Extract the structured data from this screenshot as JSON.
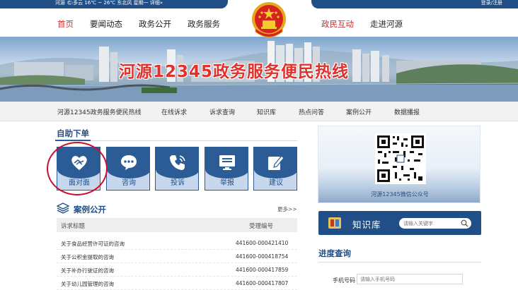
{
  "topbar": {
    "weather": "河源 🌤多云 16℃ ~ 26℃  东北风 星期一  详细»",
    "login": "登录/注册"
  },
  "nav": {
    "items": [
      "首页",
      "要闻动态",
      "政务公开",
      "政务服务",
      "政民互动",
      "走进河源"
    ],
    "active_index": 0
  },
  "banner": {
    "title": "河源12345政务服务便民热线"
  },
  "subnav": {
    "items": [
      "河源12345政务服务便民热线",
      "在线诉求",
      "诉求查询",
      "知识库",
      "热点问答",
      "案例公开",
      "数据播报"
    ]
  },
  "self_service": {
    "title": "自助下单",
    "services": [
      {
        "label": "面对面",
        "icon": "handshake-heart-icon"
      },
      {
        "label": "咨询",
        "icon": "chat-bubble-icon"
      },
      {
        "label": "投诉",
        "icon": "phone-icon"
      },
      {
        "label": "举报",
        "icon": "monitor-icon"
      },
      {
        "label": "建议",
        "icon": "pencil-note-icon"
      }
    ]
  },
  "cases": {
    "title": "案例公开",
    "more": "更多>>",
    "columns": [
      "诉求标题",
      "受理编号"
    ],
    "rows": [
      {
        "title": "关于食品经营许可证的咨询",
        "id": "441600-000421410"
      },
      {
        "title": "关于公积金提取的咨询",
        "id": "441600-000418754"
      },
      {
        "title": "关于补办行驶证的咨询",
        "id": "441600-000417859"
      },
      {
        "title": "关于幼儿园管理的咨询",
        "id": "441600-000417807"
      }
    ]
  },
  "qr": {
    "caption": "河源12345微信公众号"
  },
  "knowledge": {
    "title": "知识库",
    "placeholder": "请输入关键字"
  },
  "progress": {
    "title": "进度查询",
    "phone_label": "手机号码",
    "phone_placeholder": "请输入手机号码"
  },
  "colors": {
    "primary": "#1f4f86",
    "accent_red": "#d0312d",
    "tile_light": "#c7d8ee"
  }
}
